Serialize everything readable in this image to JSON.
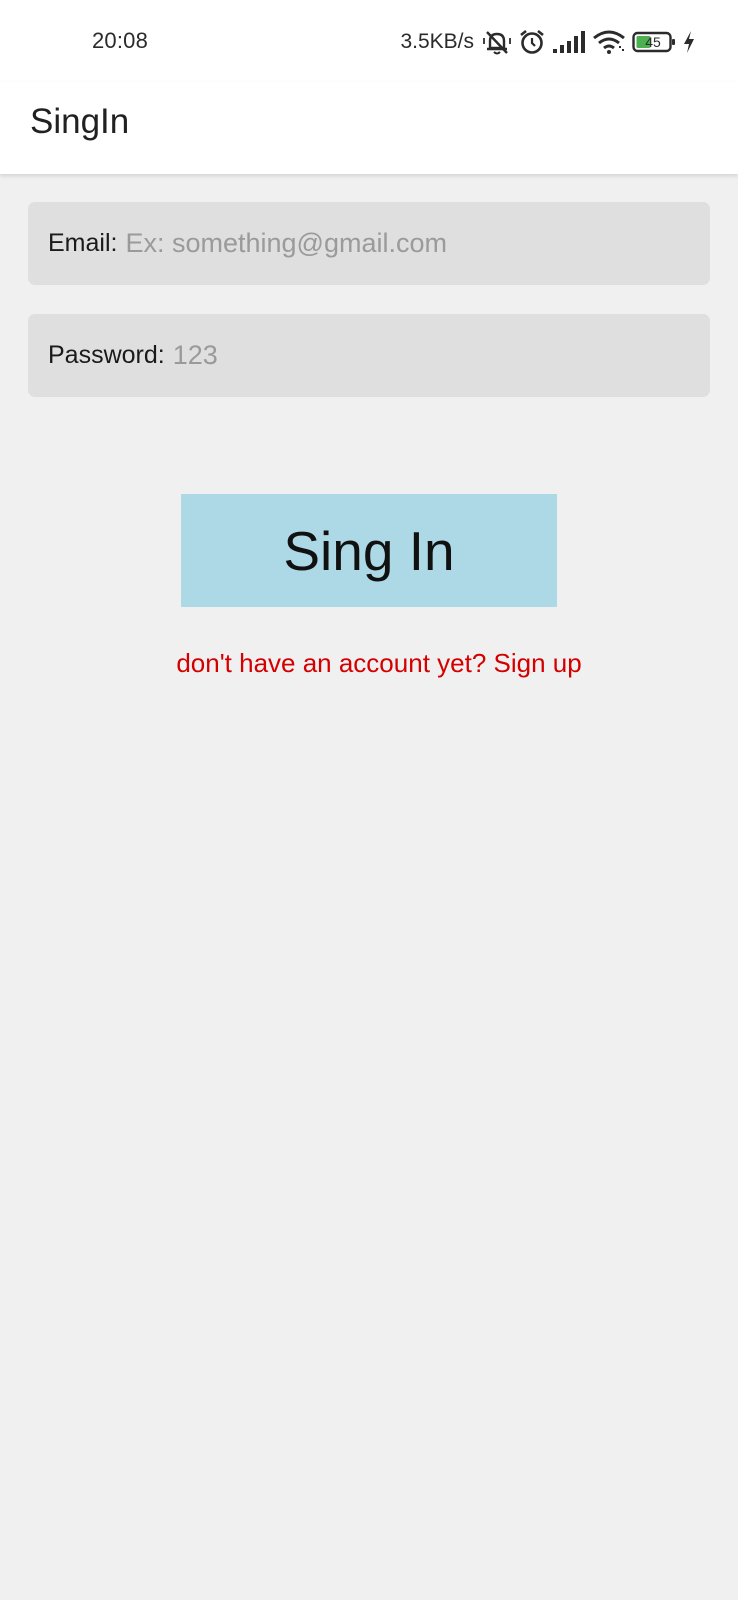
{
  "status_bar": {
    "time": "20:08",
    "net_speed": "3.5KB/s",
    "battery_level": "45",
    "icons": [
      "muted-bell-icon",
      "alarm-icon",
      "signal-icon",
      "wifi-icon",
      "battery-icon",
      "charging-icon"
    ]
  },
  "app_bar": {
    "title": "SingIn"
  },
  "form": {
    "email_label": "Email:",
    "email_placeholder": "Ex: something@gmail.com",
    "email_value": "",
    "password_label": "Password:",
    "password_placeholder": "123",
    "password_value": "",
    "signin_label": "Sing In",
    "signup_link": "don't have an account yet? Sign up"
  },
  "colors": {
    "background": "#f0f0f1",
    "button": "#add8e6",
    "link": "#d40000",
    "field": "#e0dfdf",
    "battery": "#4caf50"
  }
}
